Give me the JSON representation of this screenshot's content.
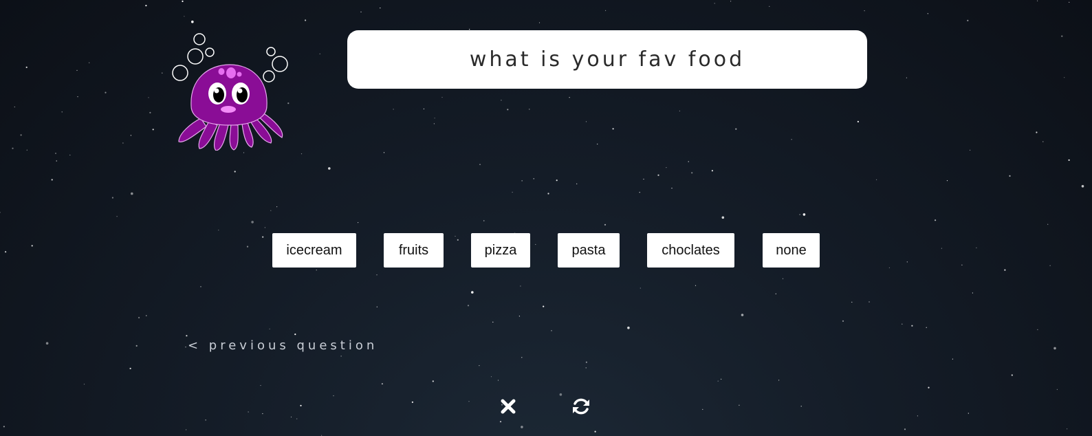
{
  "question": {
    "text": "what is your fav food"
  },
  "answers": [
    {
      "label": "icecream"
    },
    {
      "label": "fruits"
    },
    {
      "label": "pizza"
    },
    {
      "label": "pasta"
    },
    {
      "label": "choclates"
    },
    {
      "label": "none"
    }
  ],
  "navigation": {
    "previous_label": "< previous question"
  },
  "controls": {
    "close_icon": "close-icon",
    "refresh_icon": "refresh-icon"
  },
  "mascot": {
    "icon": "octopus-icon",
    "color": "#8a0d96"
  },
  "theme": {
    "background": "#141c27",
    "panel": "#ffffff"
  }
}
